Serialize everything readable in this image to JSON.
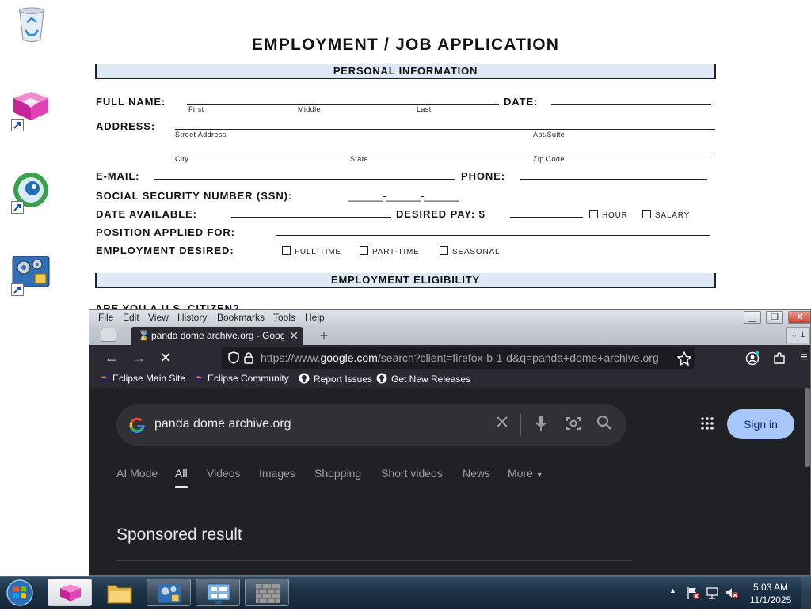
{
  "desktop": {
    "icons": [
      "recycle-bin",
      "pink-cube-app-shortcut",
      "browser-globe-shortcut",
      "settings-tool-shortcut"
    ]
  },
  "document": {
    "title": "EMPLOYMENT / JOB APPLICATION",
    "section_personal": "PERSONAL INFORMATION",
    "full_name_label": "FULL NAME:",
    "name_sub": [
      "First",
      "Middle",
      "Last"
    ],
    "date_label": "DATE:",
    "address_label": "ADDRESS:",
    "address_sub": [
      "Street Address",
      "Apt/Suite",
      "City",
      "State",
      "Zip Code"
    ],
    "email_label": "E-MAIL:",
    "phone_label": "PHONE:",
    "ssn_label": "SOCIAL SECURITY NUMBER (SSN):",
    "ssn_blank": "______-______-______",
    "date_available_label": "DATE AVAILABLE:",
    "desired_pay_label": "DESIRED PAY: $",
    "pay_options": [
      "HOUR",
      "SALARY"
    ],
    "position_label": "POSITION APPLIED FOR:",
    "employment_desired_label": "EMPLOYMENT DESIRED:",
    "employment_options": [
      "FULL-TIME",
      "PART-TIME",
      "SEASONAL"
    ],
    "section_eligibility": "EMPLOYMENT ELIGIBILITY",
    "cut_line": "ARE YOU A U.S. CITIZEN?"
  },
  "firefox": {
    "menu": [
      "File",
      "Edit",
      "View",
      "History",
      "Bookmarks",
      "Tools",
      "Help"
    ],
    "tab_title": "panda dome archive.org - Google Search",
    "tab_overflow": "1",
    "url_prefix": "https://www.",
    "url_host": "google.com",
    "url_rest": "/search?client=firefox-b-1-d&q=panda+dome+archive.org",
    "bookmarks": [
      "Eclipse Main Site",
      "Eclipse Community",
      "Report Issues",
      "Get New Releases"
    ]
  },
  "google": {
    "query": "panda dome archive.org",
    "sign_in": "Sign in",
    "tabs": [
      "AI Mode",
      "All",
      "Videos",
      "Images",
      "Shopping",
      "Short videos",
      "News",
      "More"
    ],
    "active_tab": "All",
    "sponsored_heading": "Sponsored result"
  },
  "taskbar": {
    "time": "5:03 AM",
    "date": "11/1/2025"
  },
  "colors": {
    "google_bg": "#202124",
    "search_box": "#303134",
    "sign_in_bg": "#a8c7fa",
    "firefox_toolbar": "#2b2a33",
    "section_bar": "#dfe9f6"
  }
}
